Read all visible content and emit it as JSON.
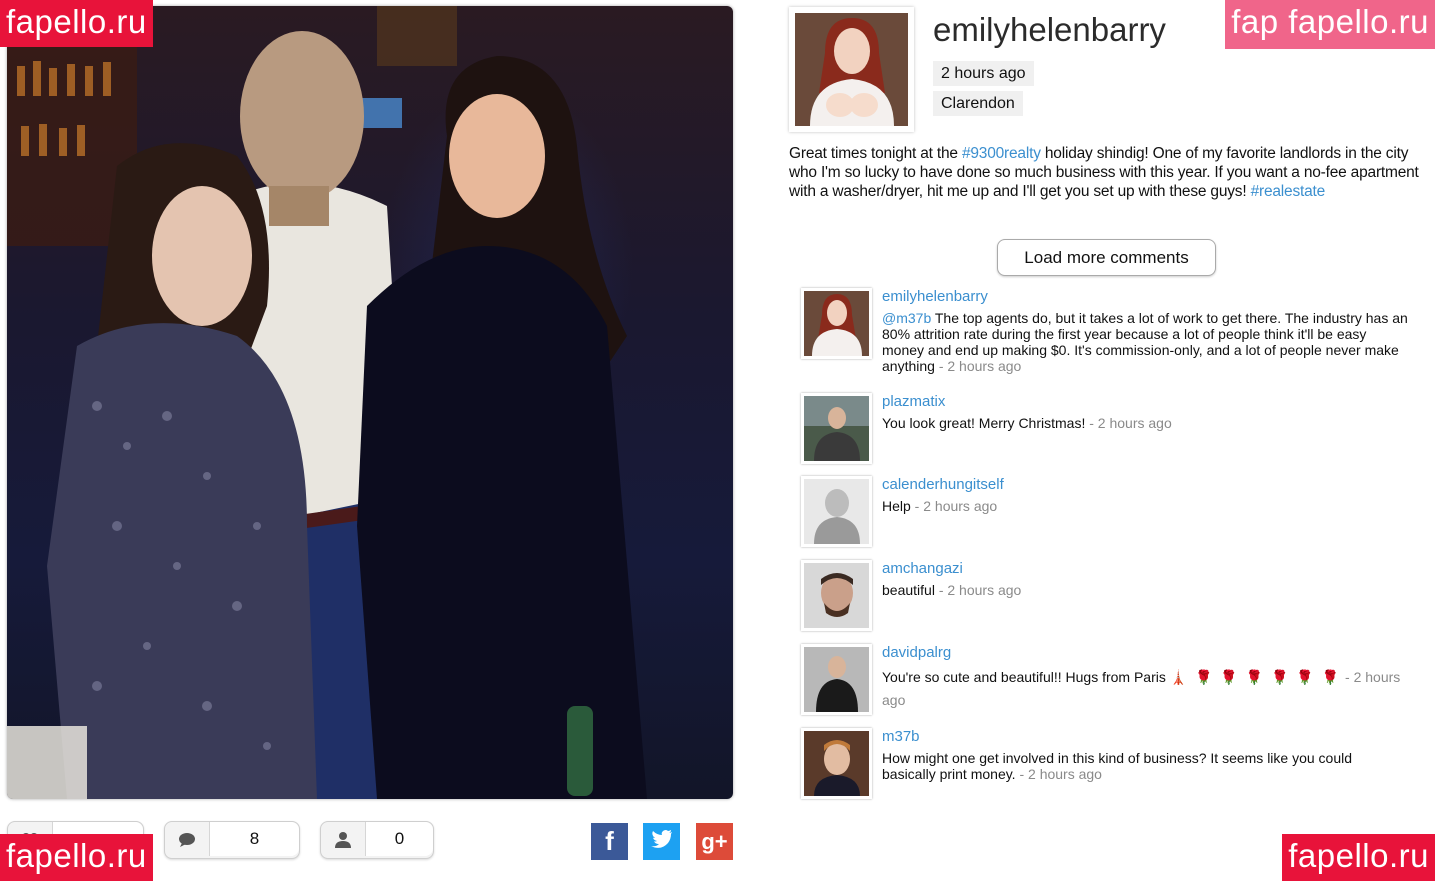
{
  "watermarks": {
    "top_left": "fapello.ru",
    "top_right": "fap fapello.ru",
    "bottom_left": "fapello.ru",
    "bottom_right": "fapello.ru"
  },
  "stats": {
    "likes": "",
    "comments": "8",
    "followers": "0"
  },
  "icons": {
    "likes": "heart-icon",
    "comments": "speech-bubble-icon",
    "followers": "user-icon",
    "facebook": "facebook-icon",
    "twitter": "twitter-icon",
    "google_plus": "google-plus-icon"
  },
  "share": {
    "facebook_glyph": "f",
    "twitter_glyph": "t",
    "google_plus_glyph": "g+"
  },
  "post": {
    "username": "emilyhelenbarry",
    "time": "2 hours ago",
    "location": "Clarendon",
    "caption_part1": "Great times tonight at the ",
    "caption_tag1": "#9300realty",
    "caption_part2": " holiday shindig! One of my favorite landlords in the city who I'm so lucky to have done so much business with this year. If you want a no-fee apartment with a washer/dryer, hit me up and I'll get you set up with these guys! ",
    "caption_tag2": "#realestate"
  },
  "load_more_label": "Load more comments",
  "comments": [
    {
      "user": "emilyhelenbarry",
      "mention": "@m37b",
      "text": " The top agents do, but it takes a lot of work to get there. The industry has an 80% attrition rate during the first year because a lot of people think it'll be easy money and end up making $0. It's commission-only, and a lot of people never make anything",
      "time": " - 2 hours ago"
    },
    {
      "user": "plazmatix",
      "text": "You look great! Merry Christmas!",
      "time": " - 2 hours ago"
    },
    {
      "user": "calenderhungitself",
      "text": "Help",
      "time": " - 2 hours ago"
    },
    {
      "user": "amchangazi",
      "text": "beautiful",
      "time": " - 2 hours ago"
    },
    {
      "user": "davidpalrg",
      "text": "You're so cute and beautiful!! Hugs from Paris ",
      "emoji": "🗼 🌹 🌹 🌹 🌹 🌹 🌹",
      "time": " - 2 hours ago"
    },
    {
      "user": "m37b",
      "text": "How might one get involved in this kind of business? It seems like you could basically print money.",
      "time": " - 2 hours ago"
    }
  ],
  "colors": {
    "link": "#3b8fcf",
    "watermark": "#e8133a",
    "facebook": "#3b5998",
    "twitter": "#1da1f2",
    "google_plus": "#dd4b39"
  }
}
